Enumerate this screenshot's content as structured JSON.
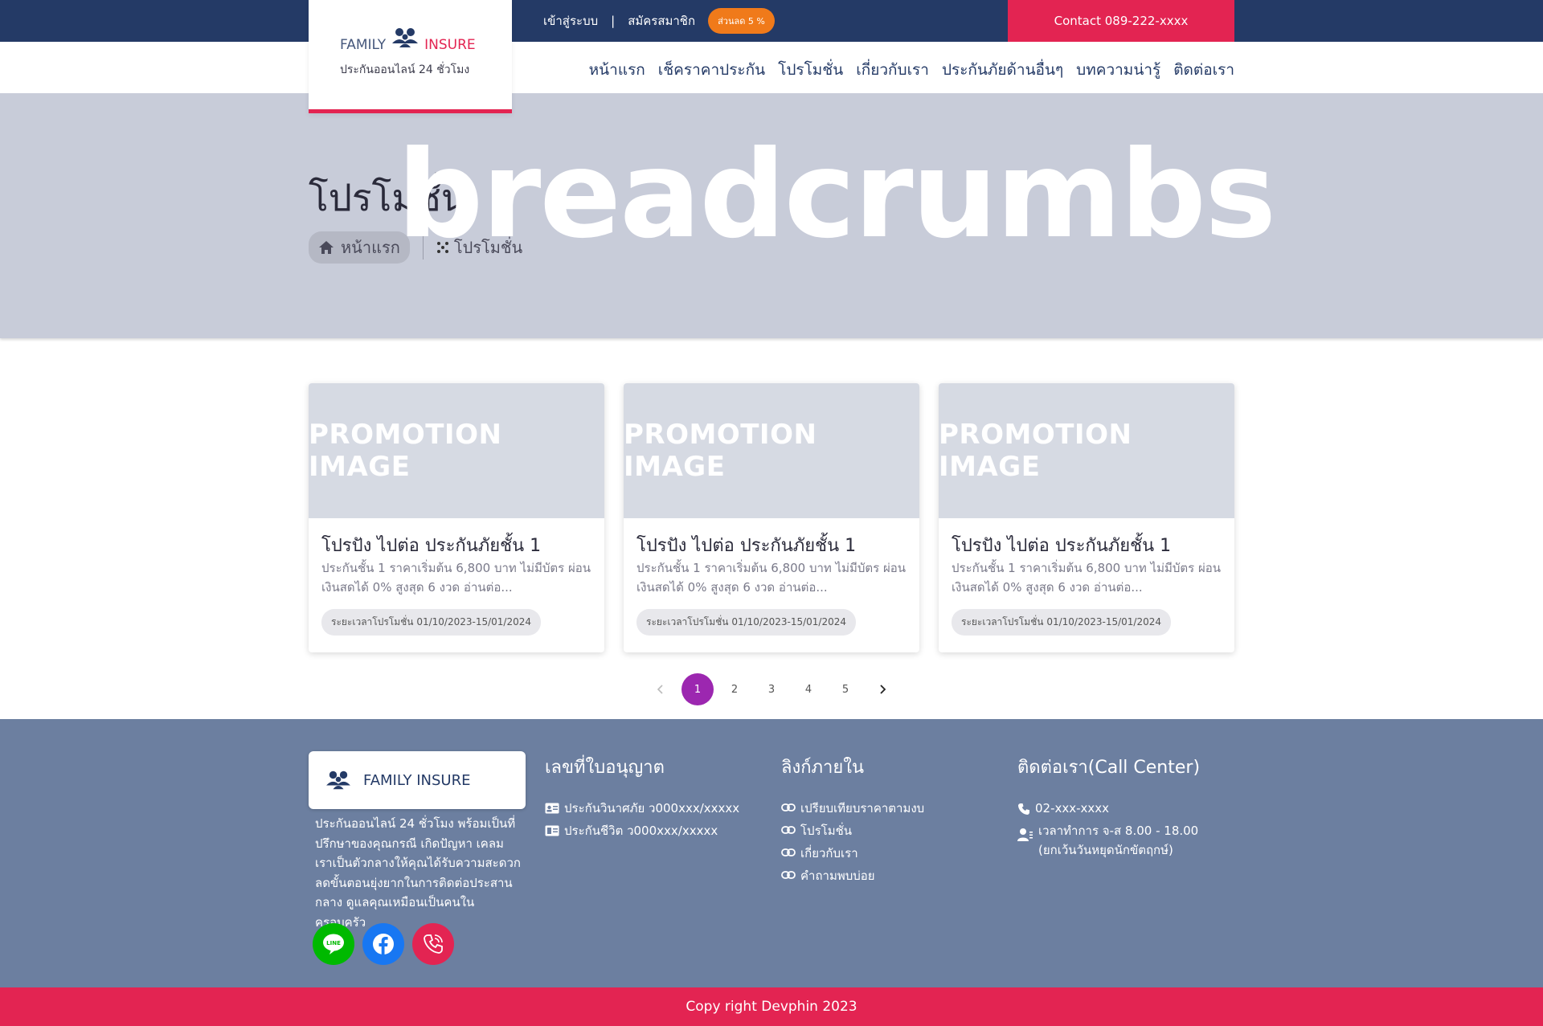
{
  "topbar": {
    "login": "เข้าสู่ระบบ",
    "separator": "|",
    "register": "สมัครสมาชิก",
    "discount_badge": "ส่วนลด 5 %",
    "contact": "Contact 089-222-xxxx"
  },
  "brand": {
    "family": "FAMILY",
    "insure": "INSURE",
    "tagline": "ประกันออนไลน์ 24 ชั่วโมง",
    "icon": "family-group-icon"
  },
  "nav": [
    {
      "label": "หน้าแรก"
    },
    {
      "label": "เช็คราคาประกัน"
    },
    {
      "label": "โปรโมชั่น"
    },
    {
      "label": "เกี่ยวกับเรา"
    },
    {
      "label": "ประกันภัยด้านอื่นๆ"
    },
    {
      "label": "บทความน่ารู้"
    },
    {
      "label": "ติดต่อเรา"
    }
  ],
  "hero": {
    "watermark": "breadcrumbs",
    "title": "โปรโมชั่น",
    "breadcrumb": {
      "home": "หน้าแรก",
      "current": "โปรโมชั่น"
    }
  },
  "cards": [
    {
      "image_text": "PROMOTION IMAGE",
      "title": "โปรปัง ไปต่อ ประกันภัยชั้น 1",
      "description": "ประกันชั้น 1 ราคาเริ่มต้น 6,800 บาท ไม่มีบัตร ผ่อนเงินสดได้ 0% สูงสุด 6 งวด อ่านต่อ...",
      "period": "ระยะเวลาโปรโมชั่น 01/10/2023-15/01/2024"
    },
    {
      "image_text": "PROMOTION IMAGE",
      "title": "โปรปัง ไปต่อ ประกันภัยชั้น 1",
      "description": "ประกันชั้น 1 ราคาเริ่มต้น 6,800 บาท ไม่มีบัตร ผ่อนเงินสดได้ 0% สูงสุด 6 งวด อ่านต่อ...",
      "period": "ระยะเวลาโปรโมชั่น 01/10/2023-15/01/2024"
    },
    {
      "image_text": "PROMOTION IMAGE",
      "title": "โปรปัง ไปต่อ ประกันภัยชั้น 1",
      "description": "ประกันชั้น 1 ราคาเริ่มต้น 6,800 บาท ไม่มีบัตร ผ่อนเงินสดได้ 0% สูงสุด 6 งวด อ่านต่อ...",
      "period": "ระยะเวลาโปรโมชั่น 01/10/2023-15/01/2024"
    }
  ],
  "pagination": {
    "prev_icon": "chevron-left-icon",
    "pages": [
      "1",
      "2",
      "3",
      "4",
      "5"
    ],
    "current": "1",
    "next_icon": "chevron-right-icon"
  },
  "footer": {
    "brand_name": "FAMILY INSURE",
    "about": "ประกันออนไลน์ 24 ชั่วโมง พร้อมเป็นที่ปรึกษาของคุณกรณี เกิดปัญหา เคลม เราเป็นตัวกลางให้คุณได้รับความสะดวก ลดขั้นตอนยุ่งยากในการติดต่อประสานกลาง ดูแลคุณเหมือนเป็นคนในครอบครัว",
    "socials": [
      "line-icon",
      "facebook-icon",
      "phone-call-icon"
    ],
    "license": {
      "heading": "เลขที่ใบอนุญาต",
      "items": [
        {
          "icon": "id-card-icon",
          "text": "ประกันวินาศภัย ว000xxx/xxxxx"
        },
        {
          "icon": "id-badge-icon",
          "text": "ประกันชีวิต ว000xxx/xxxxx"
        }
      ]
    },
    "links": {
      "heading": "ลิงก์ภายใน",
      "items": [
        {
          "icon": "link-icon",
          "text": "เปรียบเทียบราคาตามงบ"
        },
        {
          "icon": "link-icon",
          "text": "โปรโมชั่น"
        },
        {
          "icon": "link-icon",
          "text": "เกี่ยวกับเรา"
        },
        {
          "icon": "link-icon",
          "text": "คำถามพบบ่อย"
        }
      ]
    },
    "contact": {
      "heading": "ติดต่อเรา(Call Center)",
      "phone": "02-xxx-xxxx",
      "hours": "เวลาทำการ จ-ส 8.00 - 18.00 (ยกเว้นวันหยุดนักขัตฤกษ์)"
    }
  },
  "copyright": "Copy right Devphin 2023",
  "colors": {
    "navy": "#243a66",
    "brand_pink": "#e32452",
    "orange_badge": "#f07a1a",
    "hero_bg": "#c8ccd9",
    "footer_bg": "#6c7fa0",
    "pagination_active": "#9c27b0"
  }
}
